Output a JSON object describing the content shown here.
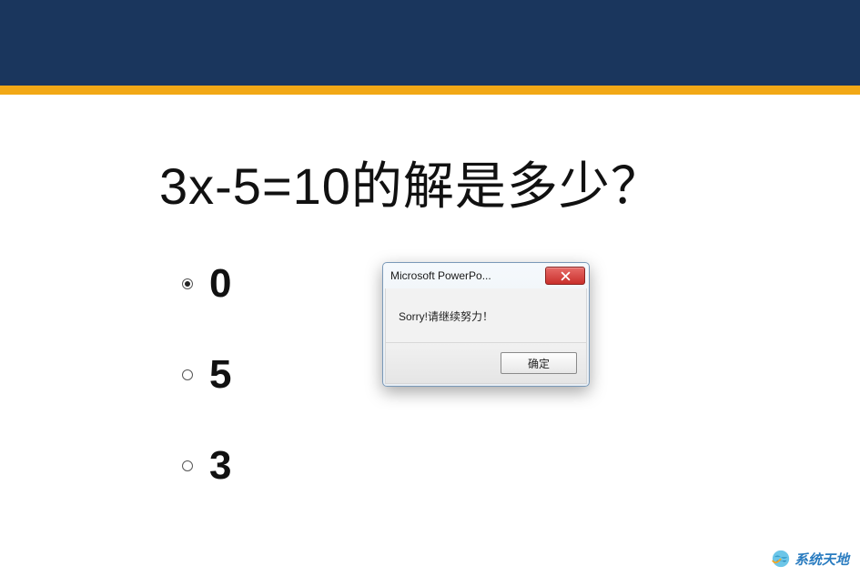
{
  "question": {
    "title": "3x-5=10的解是多少？",
    "options": [
      {
        "label": "0",
        "selected": true
      },
      {
        "label": "5",
        "selected": false
      },
      {
        "label": "3",
        "selected": false
      }
    ]
  },
  "dialog": {
    "title": "Microsoft PowerPo...",
    "message": "Sorry!请继续努力！",
    "ok_label": "确定"
  },
  "watermark": {
    "text": "系统天地"
  }
}
